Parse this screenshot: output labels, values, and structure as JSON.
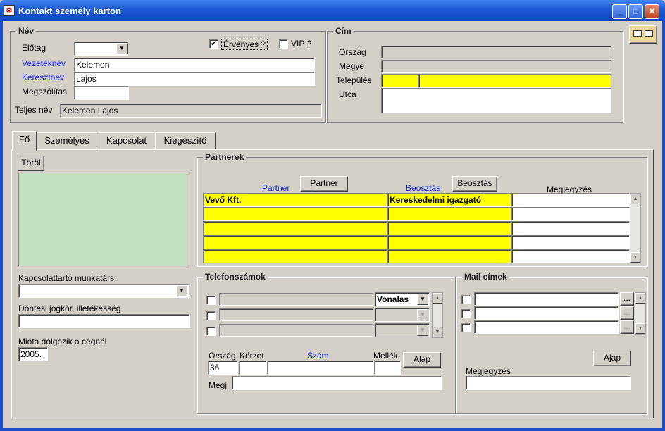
{
  "window": {
    "title": "Kontakt személy karton",
    "icon": "app-icon",
    "minimize_label": "_",
    "maximize_label": "□",
    "close_label": "✕"
  },
  "toolbar": {
    "corner_icon": "cards-icon"
  },
  "nev": {
    "group_title": "Név",
    "elotag_label": "Előtag",
    "elotag_value": "",
    "ervenyes_label": "Érvényes ?",
    "ervenyes_checked": "✔",
    "vip_label": "VIP ?",
    "vezeteknev_label": "Vezetéknév",
    "vezeteknev_value": "Kelemen",
    "keresztnev_label": "Keresztnév",
    "keresztnev_value": "Lajos",
    "megszolitas_label": "Megszólítás",
    "megszolitas_value": "",
    "teljes_nev_label": "Teljes név",
    "teljes_nev_value": "Kelemen Lajos"
  },
  "cim": {
    "group_title": "Cím",
    "orszag_label": "Ország",
    "megye_label": "Megye",
    "telepules_label": "Település",
    "utca_label": "Utca"
  },
  "tabs": [
    {
      "label": "Fő"
    },
    {
      "label": "Személyes"
    },
    {
      "label": "Kapcsolat"
    },
    {
      "label": "Kiegészítő"
    }
  ],
  "fo": {
    "torol_label": "Töröl",
    "kapcsolattarto_label": "Kapcsolattartó munkatárs",
    "kapcsolattarto_value": "",
    "dontesi_label": "Döntési jogkör, illetékesség",
    "dontesi_value": "",
    "mioda_label": "Mióta dolgozik a cégnél",
    "mioda_value": "2005."
  },
  "partnerek": {
    "group_title": "Partnerek",
    "col_partner": "Partner",
    "btn_partner_u": "P",
    "btn_partner_rest": "artner",
    "col_beosztas": "Beosztás",
    "btn_beosztas_u": "B",
    "btn_beosztas_rest": "eosztás",
    "col_megjegyzes": "Megjegyzés",
    "rows": [
      {
        "partner": "Vevő Kft.",
        "beosztas": "Kereskedelmi igazgató",
        "megjegyzes": ""
      },
      {
        "partner": "",
        "beosztas": "",
        "megjegyzes": ""
      },
      {
        "partner": "",
        "beosztas": "",
        "megjegyzes": ""
      },
      {
        "partner": "",
        "beosztas": "",
        "megjegyzes": ""
      },
      {
        "partner": "",
        "beosztas": "",
        "megjegyzes": ""
      }
    ]
  },
  "telefon": {
    "group_title": "Telefonszámok",
    "type_value": "Vonalas",
    "orszag_label": "Ország",
    "korzet_label": "Körzet",
    "szam_label": "Szám",
    "mellek_label": "Mellék",
    "orszag_value": "36",
    "alap_u": "A",
    "alap_rest": "lap",
    "megj_label": "Megj"
  },
  "mail": {
    "group_title": "Mail címek",
    "ellipsis": "...",
    "alap_u": "A",
    "alap_mid": "l",
    "alap_rest": "ap",
    "megjegyzes_label": "Megjegyzés"
  },
  "icons": {
    "checkmark": "✔",
    "arrow_down": "▼",
    "arrow_up": "▲"
  }
}
